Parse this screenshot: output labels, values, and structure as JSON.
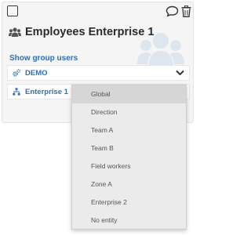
{
  "card": {
    "title": "Employees Enterprise 1",
    "show_users_link": "Show group users"
  },
  "fields": [
    {
      "label": "DEMO",
      "icon": "gears-icon"
    },
    {
      "label": "Enterprise 1",
      "icon": "sitemap-icon"
    }
  ],
  "dropdown": {
    "options": [
      "Global",
      "Direction",
      "Team A",
      "Team B",
      "Field workers",
      "Zone A",
      "Enterprise 2",
      "No entity"
    ],
    "highlighted": "Global"
  },
  "colors": {
    "link": "#2f6fb3",
    "card_bg": "#f5f5f5",
    "watermark_icon": "#dde5ee",
    "dropdown_bg": "#ebebeb"
  }
}
